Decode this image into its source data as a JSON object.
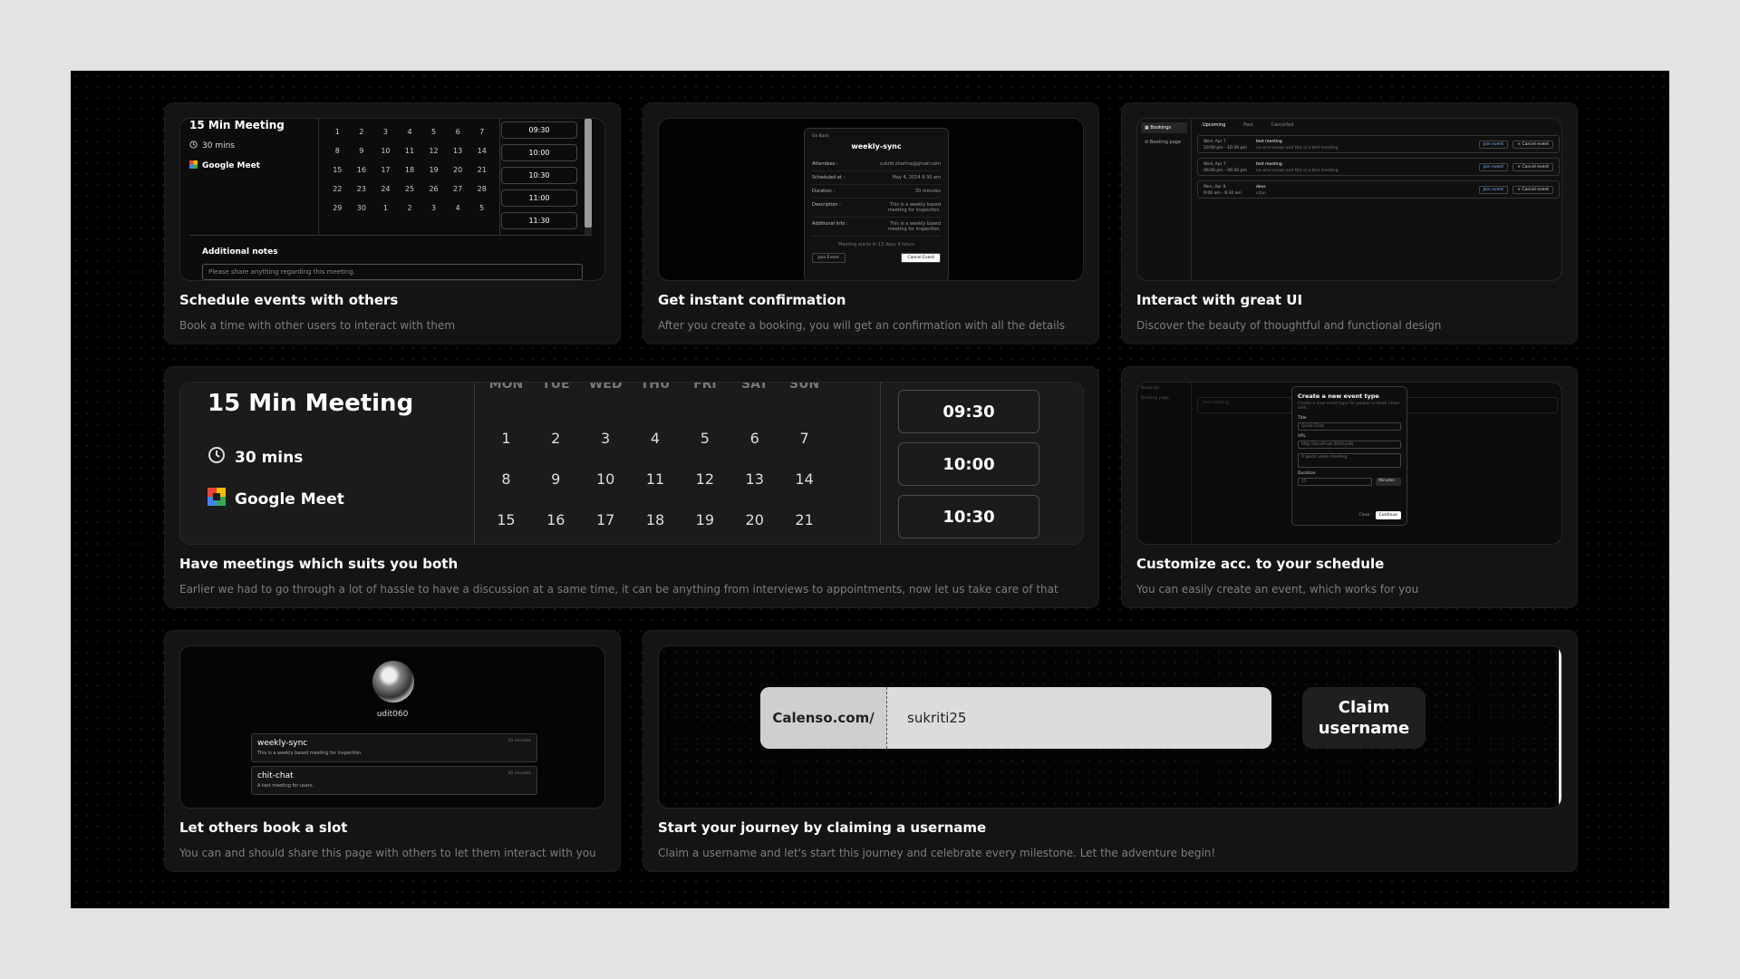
{
  "cards": {
    "schedule": {
      "title": "Schedule events with others",
      "desc": "Book a time with other users to interact with them",
      "preview": {
        "meeting": "15 Min Meeting",
        "duration": "30 mins",
        "location": "Google Meet",
        "days": [
          "1",
          "2",
          "3",
          "4",
          "5",
          "6",
          "7",
          "8",
          "9",
          "10",
          "11",
          "12",
          "13",
          "14",
          "15",
          "16",
          "17",
          "18",
          "19",
          "20",
          "21",
          "22",
          "23",
          "24",
          "25",
          "26",
          "27",
          "28",
          "29",
          "30",
          "1",
          "2",
          "3",
          "4",
          "5"
        ],
        "times": [
          "09:30",
          "10:00",
          "10:30",
          "11:00",
          "11:30"
        ],
        "notes_label": "Additional notes",
        "notes_placeholder": "Please share anything regarding this meeting."
      }
    },
    "confirm": {
      "title": "Get instant confirmation",
      "desc": "After you create a booking, you will get an confirmation with all the details",
      "preview": {
        "back": "Go Back",
        "event": "weekly-sync",
        "rows": [
          {
            "k": "Attendees :",
            "v": "sukriti.sharma@gmail.com"
          },
          {
            "k": "Scheduled at :",
            "v": "May 4, 2024 9:30 am"
          },
          {
            "k": "Duration :",
            "v": "30 minutes"
          },
          {
            "k": "Description :",
            "v": "This is a weekly based meeting for inspection."
          },
          {
            "k": "Additional Info :",
            "v": "This is a weekly based meeting for inspection."
          }
        ],
        "starts": "Meeting starts in 13 days 4 hours",
        "join": "Join Event",
        "cancel": "Cancel Event"
      }
    },
    "ui": {
      "title": "Interact with great UI",
      "desc": "Discover the beauty of thoughtful and functional design",
      "preview": {
        "nav": [
          "Bookings",
          "Booking page"
        ],
        "tabs": [
          "Upcoming",
          "Past",
          "Cancelled"
        ],
        "rows": [
          {
            "date": "Wed, Apr 7",
            "time": "10:00 pm - 10:30 pm",
            "name": "test meeting",
            "sub": "no-one knows and this is a test meeting"
          },
          {
            "date": "Wed, Apr 7",
            "time": "06:00 pm - 06:30 pm",
            "name": "test meeting",
            "sub": "no-one knows and this is a test meeting"
          },
          {
            "date": "Mon, Apr 8",
            "time": "9:00 am - 9:30 am",
            "name": "devs",
            "sub": "sitjas"
          }
        ],
        "join": "Join event",
        "cancel": "× Cancel event"
      }
    },
    "meetings": {
      "title": "Have meetings which suits you both",
      "desc": "Earlier we had to go through a lot of hassle to have a discussion at a same time, it can be anything from interviews to appointments, now let us take care of that",
      "preview": {
        "meeting": "15 Min Meeting",
        "duration": "30 mins",
        "location": "Google Meet",
        "weekdays": [
          "MON",
          "TUE",
          "WED",
          "THU",
          "FRI",
          "SAT",
          "SUN"
        ],
        "days": [
          "1",
          "2",
          "3",
          "4",
          "5",
          "6",
          "7",
          "8",
          "9",
          "10",
          "11",
          "12",
          "13",
          "14",
          "15",
          "16",
          "17",
          "18",
          "19",
          "20",
          "21"
        ],
        "times": [
          "09:30",
          "10:00",
          "10:30"
        ]
      }
    },
    "customize": {
      "title": "Customize acc. to your schedule",
      "desc": "You can easily create an event, which works for you",
      "preview": {
        "nav": [
          "Bookings",
          "Booking page"
        ],
        "bg_row": "test meeting",
        "dialog_title": "Create a new event type",
        "dialog_sub": "Create a new event type for people to book times with.",
        "title_label": "Title",
        "title_ph": "Quick Chat",
        "url_label": "URL",
        "url_value": "http://localhost:3000/udit",
        "desc_ph": "A quick video meeting",
        "duration_label": "Duration",
        "duration_value": "15",
        "duration_unit": "Minutes",
        "close": "Close",
        "continue": "Continue"
      }
    },
    "profile": {
      "title": "Let others book a slot",
      "desc": "You can and should share this page with others to let them interact with you",
      "preview": {
        "username": "udit060",
        "events": [
          {
            "name": "weekly-sync",
            "sub": "This is a weekly based meeting for inspection.",
            "dur": "15 minutes"
          },
          {
            "name": "chit-chat",
            "sub": "A test meeting for users.",
            "dur": "45 minutes"
          }
        ]
      }
    },
    "claim": {
      "title": "Start your journey by claiming a username",
      "desc": "Claim a username and let's start this journey and celebrate every milestone. Let the adventure begin!",
      "preview": {
        "prefix": "Calenso.com/",
        "value": "sukriti25",
        "button": "Claim username"
      }
    }
  }
}
